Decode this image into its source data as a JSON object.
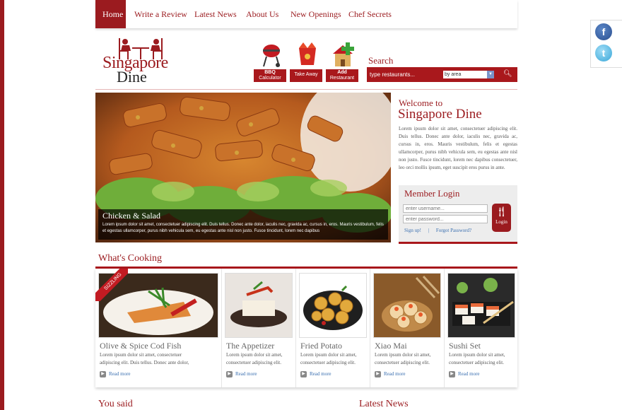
{
  "nav": {
    "items": [
      "Home",
      "Write a Review",
      "Latest News",
      "About Us",
      "New Openings",
      "Chef Secrets"
    ]
  },
  "logo": {
    "line1": "Singapore",
    "line2": "Dine"
  },
  "tools": [
    {
      "label1": "BBQ",
      "label2": "Calculator",
      "icon": "bbq-grill-icon"
    },
    {
      "label1": "Take Away",
      "label2": "",
      "icon": "takeaway-box-icon"
    },
    {
      "label1": "Add",
      "label2": "Restaurant",
      "icon": "add-restaurant-icon"
    }
  ],
  "search": {
    "title": "Search",
    "placeholder": "type restaurants...",
    "select_value": "by area",
    "icon": "search-icon"
  },
  "hero": {
    "title": "Chicken & Salad",
    "text": "Lorem ipsum dolor sit amet, consectetuer adipiscing elit. Duis tellus. Donec ante dolor, iaculis nec, gravida ac, cursus in, eros. Mauris vestibulum, felis et egestas ullamcorper, purus nibh vehicula sem, eu egestas ante nisl non justo. Fusce tincidunt, lorem nec dapibus"
  },
  "welcome": {
    "small": "Welcome to",
    "big": "Singapore Dine",
    "text": "Lorem ipsum dolor sit amet, consectetuer adipiscing elit. Duis tellus. Donec ante dolor, iaculis nec, gravida ac, cursus in, eros. Mauris vestibulum, felis et egestas ullamcorper, purus nibh vehicula sem, eu egestas ante nisl non justo. Fusce tincidunt, lorem nec dapibus consectetuer, leo orci mollis ipsum, eget suscipit eros purus in ante."
  },
  "login": {
    "title": "Member Login",
    "username_placeholder": "enter username...",
    "password_placeholder": "enter password...",
    "signup": "Sign up!",
    "separator": "|",
    "forgot": "Forgot Password?",
    "button": "Login"
  },
  "cooking": {
    "title": "What's Cooking",
    "ribbon": "SIZZLING",
    "cards": [
      {
        "title": "Olive & Spice Cod Fish",
        "text1": "Lorem ipsum dolor sit amet, consectetuer",
        "text2": "adipiscing elit. Duis tellus. Donec ante dolor,",
        "more": "Read more"
      },
      {
        "title": "The Appetizer",
        "text1": "Lorem ipsum dolor sit amet,",
        "text2": "consectetuer adipiscing elit.",
        "more": "Read more"
      },
      {
        "title": "Fried Potato",
        "text1": "Lorem ipsum dolor sit amet,",
        "text2": "consectetuer adipiscing elit.",
        "more": "Read more"
      },
      {
        "title": "Xiao Mai",
        "text1": "Lorem ipsum dolor sit amet,",
        "text2": "consectetuer adipiscing elit.",
        "more": "Read more"
      },
      {
        "title": "Sushi Set",
        "text1": "Lorem ipsum dolor sit amet,",
        "text2": "consectetuer adipiscing elit.",
        "more": "Read more"
      }
    ]
  },
  "footer": {
    "you_said": "You said",
    "latest_news": "Latest News"
  },
  "colors": {
    "brand": "#9b1b1f",
    "accent": "#a9181c",
    "link": "#3a6fb0"
  }
}
